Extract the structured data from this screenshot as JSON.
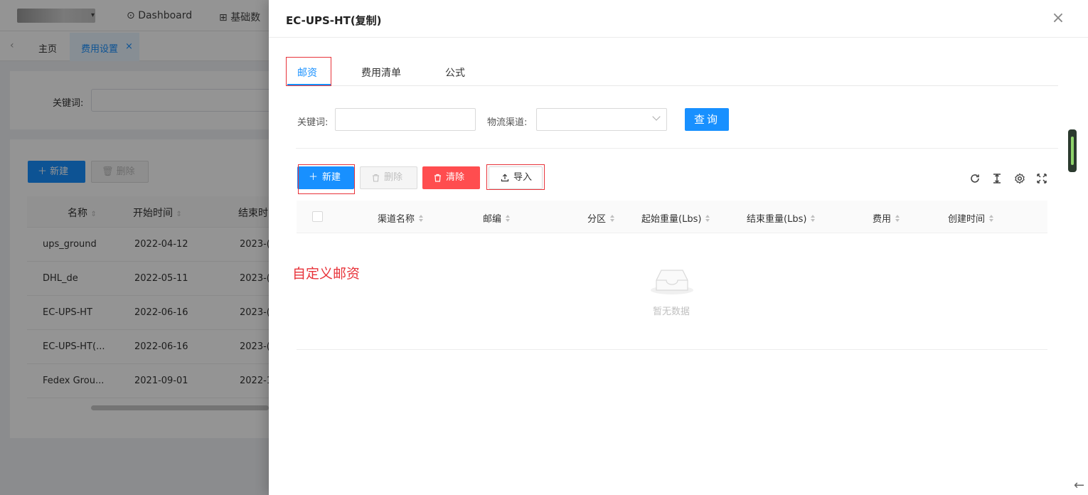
{
  "header": {
    "nav_dashboard": "Dashboard",
    "nav_basic": "基础数"
  },
  "tabbar": {
    "home": "主页",
    "active_tab": "费用设置",
    "close": "×"
  },
  "background": {
    "keyword_label": "关键词:",
    "new_label": "新建",
    "delete_label": "删除",
    "columns": [
      "名称",
      "开始时间",
      "结束时"
    ],
    "rows": [
      [
        "ups_ground",
        "2022-04-12",
        "2023-("
      ],
      [
        "DHL_de",
        "2022-05-11",
        "2023-("
      ],
      [
        "EC-UPS-HT",
        "2022-06-16",
        "2023-("
      ],
      [
        "EC-UPS-HT(...",
        "2022-06-16",
        "2023-("
      ],
      [
        "Fedex Grou...",
        "2021-09-01",
        "2022-1"
      ]
    ]
  },
  "drawer": {
    "title": "EC-UPS-HT(复制)",
    "close": "×",
    "tabs": [
      "邮资",
      "费用清单",
      "公式"
    ],
    "active_tab": 0,
    "filter": {
      "keyword_label": "关键词:",
      "keyword_value": "",
      "channel_label": "物流渠道:",
      "channel_value": "",
      "query_label": "查询"
    },
    "toolbar": {
      "new_label": "新建",
      "delete_label": "删除",
      "clear_label": "清除",
      "import_label": "导入"
    },
    "tools": [
      "refresh-icon",
      "column-height-icon",
      "setting-icon",
      "fullscreen-icon"
    ],
    "columns": [
      "渠道名称",
      "邮编",
      "分区",
      "起始重量(Lbs)",
      "结束重量(Lbs)",
      "费用",
      "创建时间"
    ],
    "annotation": "自定义邮资",
    "empty_text": "暂无数据"
  },
  "colors": {
    "primary": "#1890ff",
    "danger": "#ff4d4f",
    "highlight": "#e8333a"
  }
}
